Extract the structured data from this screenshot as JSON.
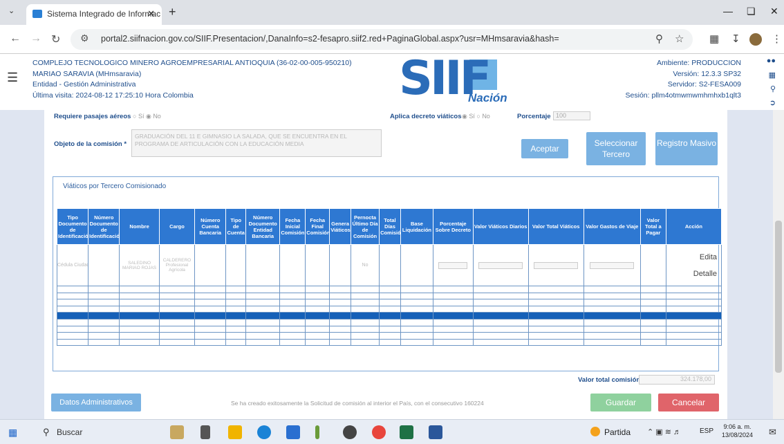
{
  "browser": {
    "tab_title": "Sistema Integrado de Informac",
    "url": "portal2.siifnacion.gov.co/SIIF.Presentacion/,DanaInfo=s2-fesapro.siif2.red+PaginaGlobal.aspx?usr=MHmsaravia&hash="
  },
  "header": {
    "org": "COMPLEJO TECNOLOGICO MINERO AGROEMPRESARIAL ANTIOQUIA (36-02-00-005-950210)",
    "user": "MARIAO SARAVIA (MHmsaravia)",
    "entity": "Entidad - Gestión Administrativa",
    "last_visit": "Última visita: 2024-08-12 17:25:10 Hora Colombia",
    "logo_text": "SIIF",
    "logo_sub": "Nación",
    "environment": "Ambiente: PRODUCCION",
    "version": "Versión: 12.3.3 SP32",
    "server": "Servidor: S2-FESA009",
    "session": "Sesión: pllm4otmwmwmhmhxb1qlt3"
  },
  "form": {
    "pasajes_label": "Requiere pasajes aéreos",
    "pasajes_si": "Sí",
    "pasajes_no": "No",
    "decreto_label": "Aplica decreto viáticos",
    "decreto_si": "Sí",
    "decreto_no": "No",
    "porcentaje_label": "Porcentaje",
    "porcentaje_value": "100",
    "objeto_label": "Objeto de la comisión *",
    "objeto_value": "GRADUACIÓN DEL 11 E GIMNASIO LA SALADA, QUE SE ENCUENTRA EN EL PROGRAMA DE ARTICULACIÓN CON LA EDUCACIÓN MEDIA",
    "btn_aceptar": "Aceptar",
    "btn_seleccionar": "Seleccionar Tercero",
    "btn_registro": "Registro Masivo"
  },
  "viaticos": {
    "title": "Viáticos por Tercero Comisionado",
    "columns": [
      "Tipo Documento de Identificación",
      "Número Documento de Identificación",
      "Nombre",
      "Cargo",
      "Número Cuenta Bancaria",
      "Tipo de Cuenta",
      "Número Documento Entidad Bancaria",
      "Fecha Inicial Comisión",
      "Fecha Final Comisión",
      "Genera Viáticos",
      "Pernocta Último Día de Comisión",
      "Total Días Comisión",
      "Base Liquidación",
      "Porcentaje Sobre Decreto",
      "Valor Viáticos Diarios",
      "Valor Total Viáticos",
      "Valor Gastos de Viaje",
      "Valor Total a Pagar",
      "Acción"
    ],
    "row1": [
      "Cédula Ciudadanía",
      "",
      "SALEDINO MARIAO ROJAS",
      "CALDERERO Profesional Agrícola",
      "",
      "",
      "",
      "",
      "",
      "",
      "No",
      "",
      "",
      "",
      "",
      "",
      "",
      "",
      ""
    ],
    "accion_editar": "Edita",
    "accion_detalle": "Detalle"
  },
  "footer": {
    "total_label": "Valor total comisión",
    "total_value": "324.178,00",
    "btn_datos": "Datos Administrativos",
    "message": "Se ha creado exitosamente la Solicitud de comisión al interior el País, con el consecutivo 160224",
    "btn_guardar": "Guardar",
    "btn_cancelar": "Cancelar"
  },
  "taskbar": {
    "search": "Buscar",
    "weather": "Partida",
    "lang": "ESP",
    "time": "9:06 a. m.",
    "date": "13/08/2024"
  }
}
